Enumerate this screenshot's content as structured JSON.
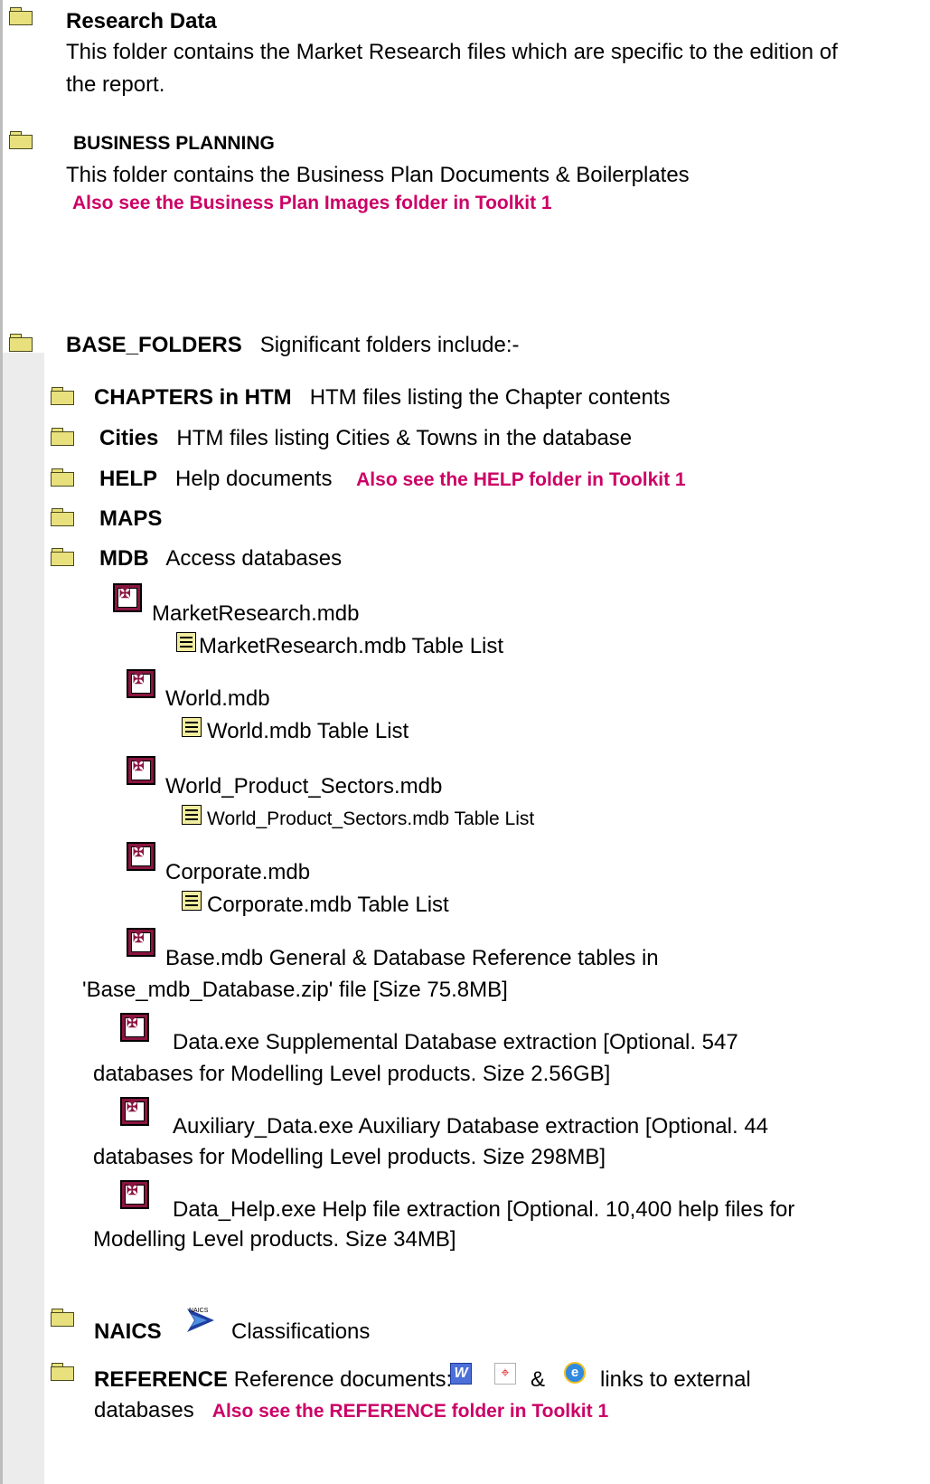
{
  "research": {
    "title": "Research Data",
    "desc1": "This folder contains the Market Research files which are specific to the edition of",
    "desc2": "the report."
  },
  "business": {
    "title": "BUSINESS PLANNING",
    "desc": "This folder contains the Business Plan Documents & Boilerplates",
    "link": "Also see the Business Plan Images folder in Toolkit 1"
  },
  "base": {
    "title": "BASE_FOLDERS",
    "desc": "Significant folders include:-"
  },
  "chapters": {
    "title": "CHAPTERS in HTM",
    "desc": "HTM files listing the Chapter contents"
  },
  "cities": {
    "title": "Cities",
    "desc": "HTM files listing Cities & Towns in the database"
  },
  "help": {
    "title": "HELP",
    "desc": "Help documents",
    "link": "Also see the HELP folder in Toolkit 1"
  },
  "maps": {
    "title": "MAPS"
  },
  "mdb": {
    "title": "MDB",
    "desc": "Access databases"
  },
  "db1": {
    "name": "MarketResearch.mdb",
    "list": "MarketResearch.mdb Table List"
  },
  "db2": {
    "name": "World.mdb",
    "list": "World.mdb Table List"
  },
  "db3": {
    "name": "World_Product_Sectors.mdb",
    "list": "World_Product_Sectors.mdb Table List"
  },
  "db4": {
    "name": "Corporate.mdb",
    "list": "Corporate.mdb Table List"
  },
  "db5": {
    "line1": "Base.mdb   General & Database Reference tables in",
    "line2": "'Base_mdb_Database.zip' file [Size 75.8MB]"
  },
  "db6": {
    "line1": "Data.exe   Supplemental Database extraction [Optional. 547",
    "line2": "databases for Modelling Level products. Size 2.56GB]"
  },
  "db7": {
    "line1": "Auxiliary_Data.exe   Auxiliary Database extraction [Optional. 44",
    "line2": "databases for Modelling Level products. Size 298MB]"
  },
  "db8": {
    "line1": "Data_Help.exe   Help file extraction [Optional. 10,400 help files for",
    "line2": "Modelling Level products. Size 34MB]"
  },
  "naics": {
    "title": "NAICS",
    "icon_text": "NAICS",
    "desc": "Classifications"
  },
  "reference": {
    "title": "REFERENCE",
    "desc": "Reference documents:",
    "amp": "&",
    "tail": "links to external",
    "line2": "databases",
    "link": "Also see the REFERENCE folder in Toolkit 1"
  },
  "icons": {
    "folder": "folder-icon",
    "database": "access-database-icon",
    "document": "document-icon",
    "word": "word-icon",
    "pdf": "pdf-icon",
    "ie": "internet-explorer-icon",
    "naics": "naics-logo-icon"
  },
  "colors": {
    "link": "#cc0066",
    "folder": "#e8e07c",
    "db": "#8a1540"
  }
}
